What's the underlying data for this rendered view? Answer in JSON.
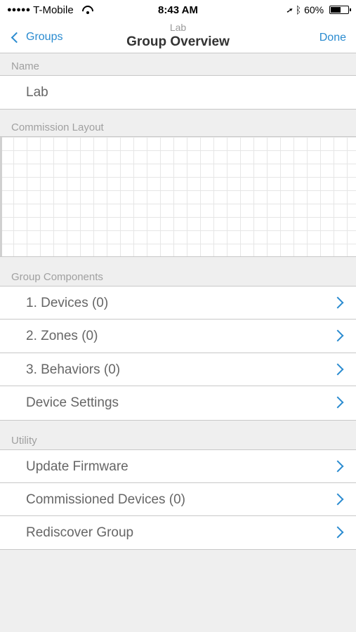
{
  "status_bar": {
    "signal_dots": "●●●●●",
    "carrier": "T-Mobile",
    "time": "8:43 AM",
    "battery_text": "60%",
    "battery_level": 0.6,
    "location_glyph": "➚",
    "bluetooth_glyph": "ᛒ"
  },
  "nav": {
    "back_label": "Groups",
    "subtitle": "Lab",
    "title": "Group Overview",
    "done_label": "Done"
  },
  "sections": {
    "name_header": "Name",
    "name_value": "Lab",
    "layout_header": "Commission Layout",
    "components_header": "Group Components",
    "utility_header": "Utility"
  },
  "components": [
    {
      "label": "1. Devices (0)"
    },
    {
      "label": "2. Zones (0)"
    },
    {
      "label": "3. Behaviors (0)"
    },
    {
      "label": "Device Settings"
    }
  ],
  "utility": [
    {
      "label": "Update Firmware"
    },
    {
      "label": "Commissioned Devices (0)"
    },
    {
      "label": "Rediscover Group"
    }
  ],
  "colors": {
    "accent": "#2a8bd0",
    "background": "#efefef"
  }
}
